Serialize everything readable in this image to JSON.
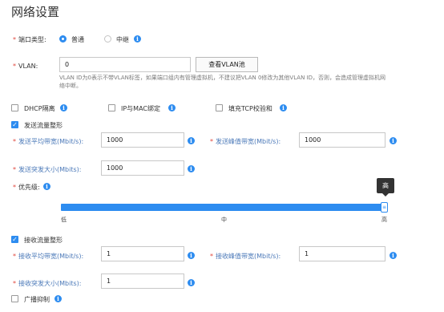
{
  "page_title": "网络设置",
  "port_type": {
    "label": "端口类型:",
    "options": [
      {
        "label": "普通",
        "selected": true
      },
      {
        "label": "中继",
        "selected": false
      }
    ]
  },
  "vlan": {
    "label": "VLAN:",
    "value": "0",
    "button_label": "查看VLAN池",
    "hint_line1": "VLAN ID为0表示不带VLAN标签，如果端口组内有管理虚拟机，不建议把VLAN 0修改为其他VLAN ID，否则，会造成管理虚拟机网",
    "hint_line2": "络中断。"
  },
  "options": {
    "dhcp_isolation": {
      "label": "DHCP隔离",
      "checked": false
    },
    "ip_mac_binding": {
      "label": "IP与MAC绑定",
      "checked": false
    },
    "fill_tcp_checksum": {
      "label": "填充TCP校验和",
      "checked": false
    }
  },
  "send_shaping": {
    "label": "发送流量整形",
    "checked": true,
    "avg_bandwidth_label": "发送平均带宽(Mbit/s):",
    "avg_bandwidth_value": "1000",
    "peak_bandwidth_label": "发送峰值带宽(Mbit/s):",
    "peak_bandwidth_value": "1000",
    "burst_size_label": "发送突发大小(Mbits):",
    "burst_size_value": "1000"
  },
  "priority": {
    "label": "优先级:",
    "levels": [
      "低",
      "中",
      "高"
    ],
    "current": "高",
    "current_fraction": 1.0,
    "tooltip": "高"
  },
  "receive_shaping": {
    "label": "接收流量整形",
    "checked": true,
    "avg_bandwidth_label": "接收平均带宽(Mbit/s):",
    "avg_bandwidth_value": "1",
    "peak_bandwidth_label": "接收峰值带宽(Mbit/s):",
    "peak_bandwidth_value": "1",
    "burst_size_label": "接收突发大小(Mbits):",
    "burst_size_value": "1"
  },
  "broadcast_suppression": {
    "label": "广播抑制",
    "checked": false
  },
  "colors": {
    "accent": "#2d8cf0",
    "required": "#e0463c",
    "tooltip_bg": "#333333"
  },
  "icons": {
    "info": "info-icon",
    "check": "check-icon",
    "slider_thumb": "slider-handle"
  }
}
